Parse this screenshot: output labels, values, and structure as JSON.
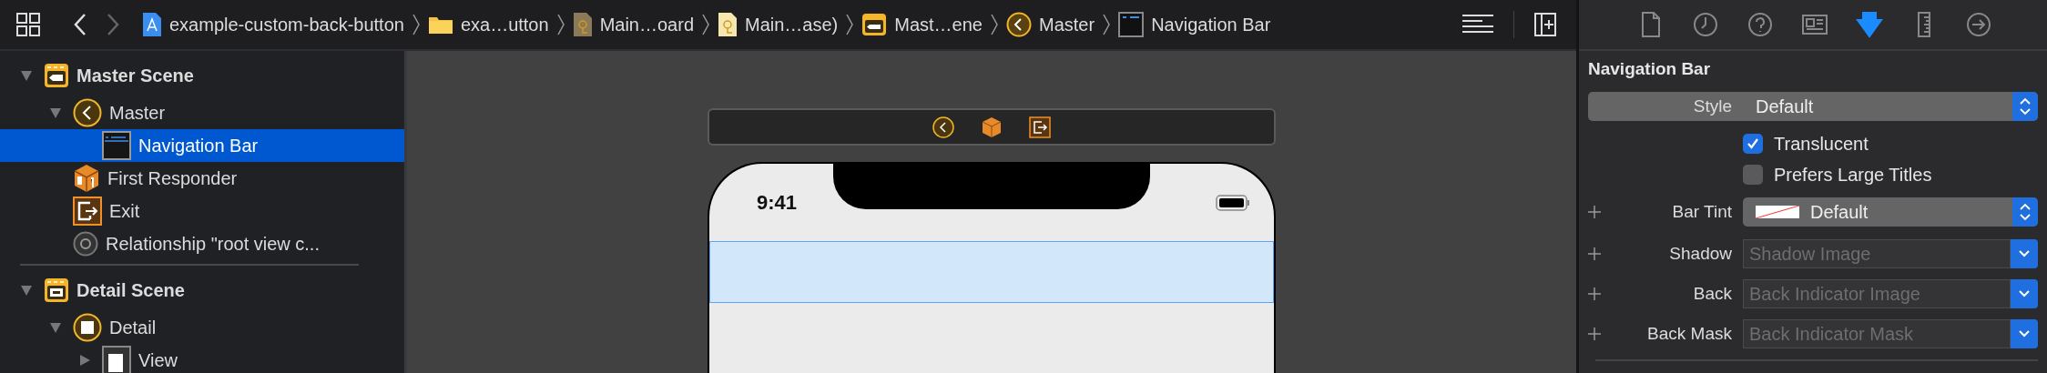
{
  "toolbar": {
    "back_enabled": true,
    "forward_enabled": false
  },
  "breadcrumbs": [
    {
      "label": "example-custom-back-button",
      "kind": "project"
    },
    {
      "label": "exa…utton",
      "kind": "folder"
    },
    {
      "label": "Main…oard",
      "kind": "storyboard"
    },
    {
      "label": "Main…ase)",
      "kind": "storyboard-base"
    },
    {
      "label": "Mast…ene",
      "kind": "scene"
    },
    {
      "label": "Master",
      "kind": "controller"
    },
    {
      "label": "Navigation Bar",
      "kind": "navbar"
    }
  ],
  "outline": [
    {
      "label": "Master Scene",
      "kind": "scene",
      "expanded": true,
      "selected": false,
      "children": [
        {
          "label": "Master",
          "kind": "controller",
          "expanded": true,
          "selected": false,
          "children": [
            {
              "label": "Navigation Bar",
              "kind": "navbar",
              "selected": true
            }
          ]
        },
        {
          "label": "First Responder",
          "kind": "responder",
          "selected": false
        },
        {
          "label": "Exit",
          "kind": "exit",
          "selected": false
        },
        {
          "label": "Relationship \"root view c...",
          "kind": "relationship",
          "selected": false
        }
      ]
    },
    {
      "label": "Detail Scene",
      "kind": "scene",
      "expanded": true,
      "selected": false,
      "children": [
        {
          "label": "Detail",
          "kind": "detail",
          "expanded": true,
          "selected": false,
          "children": [
            {
              "label": "View",
              "kind": "view",
              "expanded": false,
              "selected": false
            }
          ]
        }
      ]
    }
  ],
  "canvas": {
    "dock": [
      {
        "kind": "controller"
      },
      {
        "kind": "responder"
      },
      {
        "kind": "exit"
      }
    ],
    "status_time": "9:41",
    "navigation_bar_selected": true
  },
  "inspector": {
    "tabs": [
      {
        "kind": "file",
        "selected": false
      },
      {
        "kind": "history",
        "selected": false
      },
      {
        "kind": "help",
        "selected": false
      },
      {
        "kind": "identity",
        "selected": false
      },
      {
        "kind": "attributes",
        "selected": true
      },
      {
        "kind": "size",
        "selected": false
      },
      {
        "kind": "connections",
        "selected": false
      }
    ],
    "section": "Navigation Bar",
    "fields": [
      {
        "kind": "popup",
        "label": "Style",
        "value": "Default"
      },
      {
        "kind": "checkbox",
        "label": "Translucent",
        "checked": true
      },
      {
        "kind": "checkbox",
        "label": "Prefers Large Titles",
        "checked": false
      },
      {
        "kind": "color",
        "label": "Bar Tint",
        "value": "Default"
      },
      {
        "kind": "image",
        "label": "Shadow",
        "placeholder": "Shadow Image"
      },
      {
        "kind": "image",
        "label": "Back",
        "placeholder": "Back Indicator Image"
      },
      {
        "kind": "image",
        "label": "Back Mask",
        "placeholder": "Back Indicator Mask"
      }
    ]
  }
}
